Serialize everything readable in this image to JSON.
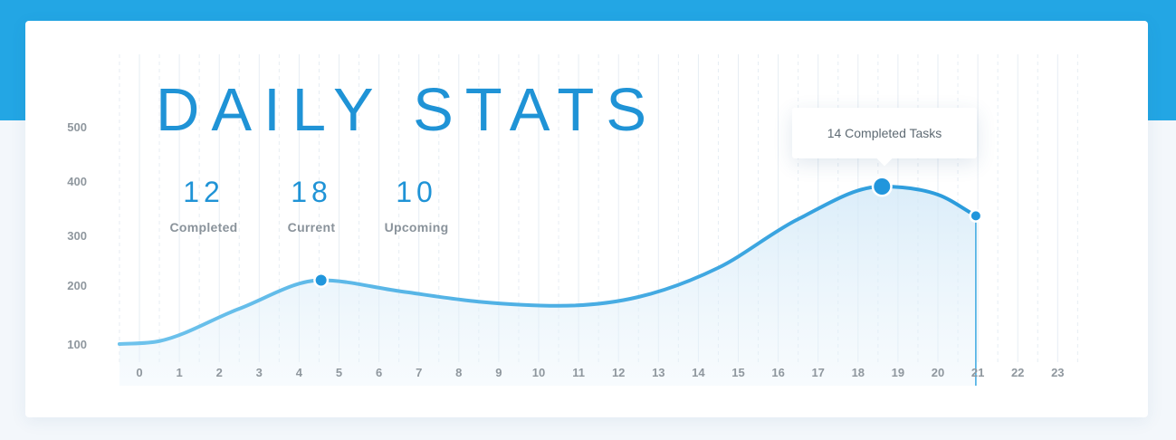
{
  "title": "DAILY STATS",
  "stats": [
    {
      "value": "12",
      "label": "Completed"
    },
    {
      "value": "18",
      "label": "Current"
    },
    {
      "value": "10",
      "label": "Upcoming"
    }
  ],
  "tooltip": "14 Completed Tasks",
  "colors": {
    "accent": "#23a6e4",
    "title": "#1f93d6",
    "line": "#3aa8e1",
    "background": "#f3f7fb",
    "card": "#ffffff"
  },
  "chart_data": {
    "type": "line",
    "title": "DAILY STATS",
    "xlabel": "",
    "ylabel": "",
    "x_ticks": [
      0,
      1,
      2,
      3,
      4,
      5,
      6,
      7,
      8,
      9,
      10,
      11,
      12,
      13,
      14,
      15,
      16,
      17,
      18,
      19,
      20,
      21,
      22,
      23
    ],
    "y_ticks": [
      100,
      200,
      300,
      400,
      500
    ],
    "xlim": [
      0,
      23
    ],
    "series": [
      {
        "x": [
          -0.5,
          0.5,
          2.5,
          4.55,
          6.5,
          8.5,
          10.5,
          12.5,
          14.5,
          16.5,
          18.6,
          20.0,
          20.95
        ],
        "values": [
          100,
          105,
          160,
          210,
          190,
          172,
          165,
          180,
          235,
          330,
          390,
          375,
          336
        ],
        "highlighted_x": [
          4.55,
          18.6,
          20.95
        ]
      }
    ],
    "current_hour": 21,
    "grid": true,
    "legend": "none"
  }
}
